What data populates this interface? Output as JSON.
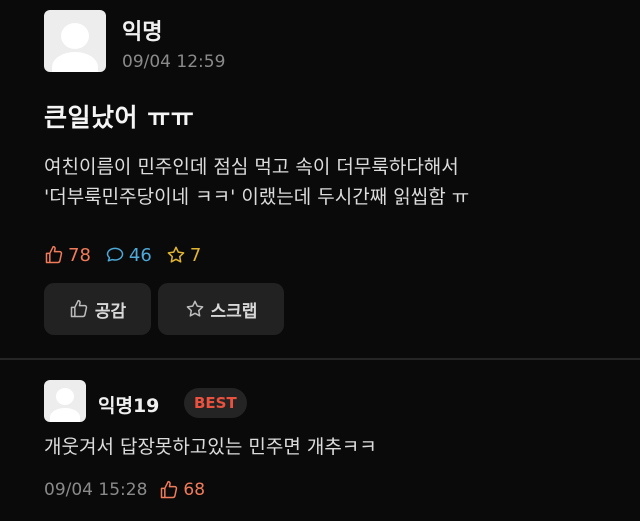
{
  "post": {
    "author": "익명",
    "time": "09/04 12:59",
    "title": "큰일났어 ㅠㅠ",
    "body": [
      "여친이름이 민주인데 점심 먹고 속이 더무룩하다해서",
      "'더부룩민주당이네 ㅋㅋ' 이랬는데 두시간째 읽씹함 ㅠ"
    ],
    "stats": {
      "likes": "78",
      "comments": "46",
      "scraps": "7"
    },
    "like_button": "공감",
    "scrap_button": "스크랩"
  },
  "comment": {
    "author": "익명19",
    "badge": "BEST",
    "text": "개웃겨서 답장못하고있는 민주면 개추ㅋㅋ",
    "time": "09/04 15:28",
    "likes": "68"
  },
  "colors": {
    "like": "#f07b5a",
    "comment": "#4ea8d8",
    "scrap": "#e0b431",
    "best": "#e8523f",
    "background": "#0a0a0a"
  },
  "icons": [
    "thumbs-up-icon",
    "speech-bubble-icon",
    "star-icon"
  ]
}
